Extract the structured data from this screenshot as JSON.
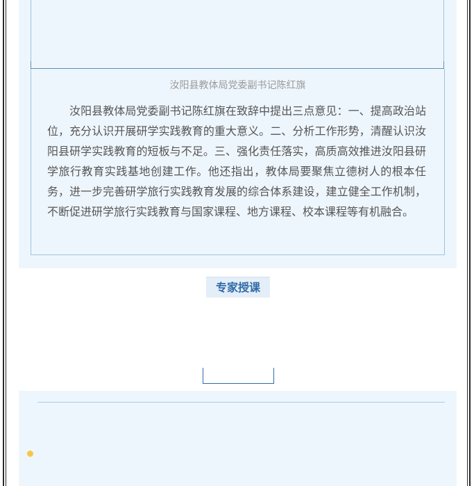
{
  "article": {
    "photo_caption": "汝阳县教体局党委副书记陈红旗",
    "paragraph": "汝阳县教体局党委副书记陈红旗在致辞中提出三点意见：一、提高政治站位，充分认识开展研学实践教育的重大意义。二、分析工作形势，清醒认识汝阳县研学实践教育的短板与不足。三、强化责任落实，高质高效推进汝阳县研学旅行教育实践基地创建工作。他还指出，教体局要聚焦立德树人的根本任务，进一步完善研学旅行实践教育发展的综合体系建设，建立健全工作机制，不断促进研学旅行实践教育与国家课程、地方课程、校本课程等有机融合。"
  },
  "section": {
    "title": "专家授课"
  },
  "colors": {
    "panel_bg": "#eef6fd",
    "accent_blue": "#2e6aa7",
    "bullet_yellow": "#f6c744"
  }
}
